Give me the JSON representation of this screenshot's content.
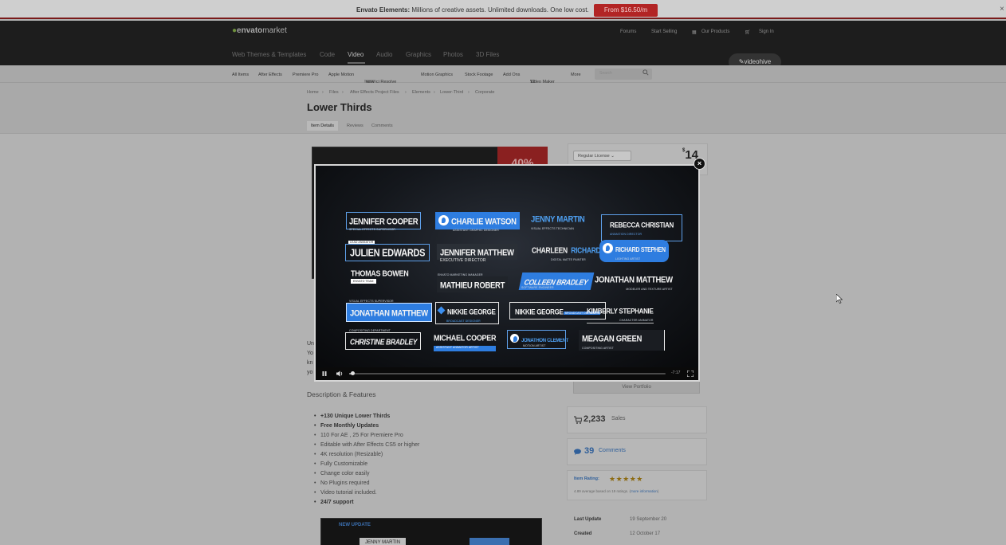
{
  "promo": {
    "bold": "Envato Elements:",
    "text": " Millions of creative assets. Unlimited downloads. One low cost.",
    "button": "From $16.50/m",
    "close": "×"
  },
  "header": {
    "logo_a": "envato",
    "logo_b": "market",
    "links": [
      "Forums",
      "Start Selling",
      "Our Products",
      "Sign In"
    ],
    "categories": [
      "Web Themes & Templates",
      "Code",
      "Video",
      "Audio",
      "Graphics",
      "Photos",
      "3D Files"
    ],
    "active_category": "Video",
    "badge": "videohive"
  },
  "subnav": {
    "items": [
      "All Items",
      "After Effects",
      "Premiere Pro",
      "Apple Motion",
      "DaVinci Resolve",
      "Motion Graphics",
      "Stock Footage",
      "Add Ons",
      "Video Maker",
      "More"
    ],
    "new_badge": "NEW",
    "video_maker_num": "12",
    "search_placeholder": "Search"
  },
  "breadcrumb": [
    "Home",
    "Files",
    "After Effects Project Files",
    "Elements",
    "Lower-Third",
    "Corporate"
  ],
  "page_title": "Lower Thirds",
  "tabs": [
    "Item Details",
    "Reviews",
    "Comments"
  ],
  "preview": {
    "sale": "40%"
  },
  "left_snippets": [
    "Un",
    "Yo",
    "kn",
    "yo"
  ],
  "description": {
    "heading": "Description & Features",
    "features": [
      {
        "text": "+130 Unique Lower Thirds",
        "bold": true
      },
      {
        "text": "Free Monthly Updates",
        "bold": true
      },
      {
        "text": "110 For AE , 25 For Premiere Pro",
        "bold": false
      },
      {
        "text": "Editable with After Effects CS5 or higher",
        "bold": false
      },
      {
        "text": "4K resolution (Resizable)",
        "bold": false
      },
      {
        "text": "Fully Customizable",
        "bold": false
      },
      {
        "text": "Change color easily",
        "bold": false
      },
      {
        "text": "No Plugins required",
        "bold": false
      },
      {
        "text": "Video tutorial included.",
        "bold": false
      },
      {
        "text": "24/7 support",
        "bold": true
      }
    ],
    "bottom_preview": {
      "label": "NEW UPDATE",
      "name": "JENNY MARTIN"
    }
  },
  "sidebar": {
    "license": "Regular License",
    "price_currency": "$",
    "price": "14",
    "portfolio": "View Portfolio",
    "sales_count": "2,233",
    "sales_label": "Sales",
    "comments_count": "39",
    "comments_label": "Comments",
    "rating_label": "Item Rating:",
    "stars": "★★★★★",
    "rating_text": "4.89 average based on 19 ratings. (",
    "rating_link": "more information",
    "rating_close": ")",
    "last_update_label": "Last Update",
    "last_update": "19 September 20",
    "created_label": "Created",
    "created": "12 October 17"
  },
  "modal": {
    "close": "×",
    "lower_thirds": [
      {
        "name": "JENNIFER COOPER",
        "sub": "SPECIAL EFFECTS SUPERVISOR"
      },
      {
        "name": "CHARLIE WATSON",
        "sub": "ASSISTANT GRAPHIC DESIGNER"
      },
      {
        "name": "JENNY MARTIN",
        "sub": "VISUAL EFFECTS TECHNICIAN"
      },
      {
        "name": "REBECCA CHRISTIAN",
        "sub": "ANIMATION DIRECTOR"
      },
      {
        "name": "JULIEN EDWARDS",
        "sub": "LEAD ANIMATOR"
      },
      {
        "name": "JENNIFER MATTHEW",
        "sub": "EXECUTIVE DIRECTOR"
      },
      {
        "name_a": "CHARLEEN",
        "name_b": "RICHARDS",
        "sub": "DIGITAL MATTE PAINTER"
      },
      {
        "name": "RICHARD STEPHEN",
        "sub": "LIGHTING ARTIST"
      },
      {
        "name": "THOMAS BOWEN",
        "sub": "ENVATO TEAM"
      },
      {
        "name": "MATHIEU ROBERT",
        "sub": "ENVATO MARKETING MANAGER"
      },
      {
        "name": "COLLEEN BRADLEY",
        "sub": "SOFTWARE ENGINEER"
      },
      {
        "name": "JONATHAN MATTHEW",
        "sub": "MODELER AND TEXTURE ARTIST"
      },
      {
        "name": "JONATHAN MATTHEW",
        "sub": "VISUAL EFFECTS SUPERVISOR"
      },
      {
        "name": "NIKKIE GEORGE",
        "sub": "BROADCAST DESIGNER"
      },
      {
        "name": "NIKKIE GEORGE",
        "sub": "BROADCAST DESIGNER"
      },
      {
        "name": "KIMBERLY STEPHANIE",
        "sub": "CHARACTER ANIMATOR"
      },
      {
        "name": "CHRISTINE BRADLEY",
        "sub": "COMPOSITING DEPARTMENT"
      },
      {
        "name": "MICHAEL COOPER",
        "sub": "ASSISTANT ANIMATOR ARTIST"
      },
      {
        "name": "JONATHON CLEMENT",
        "sub": "MOTION ARTIST"
      },
      {
        "name": "MEAGAN GREEN",
        "sub": "COMPOSITING ARTIST"
      }
    ],
    "time": "-7:17",
    "progress": 0.01
  }
}
